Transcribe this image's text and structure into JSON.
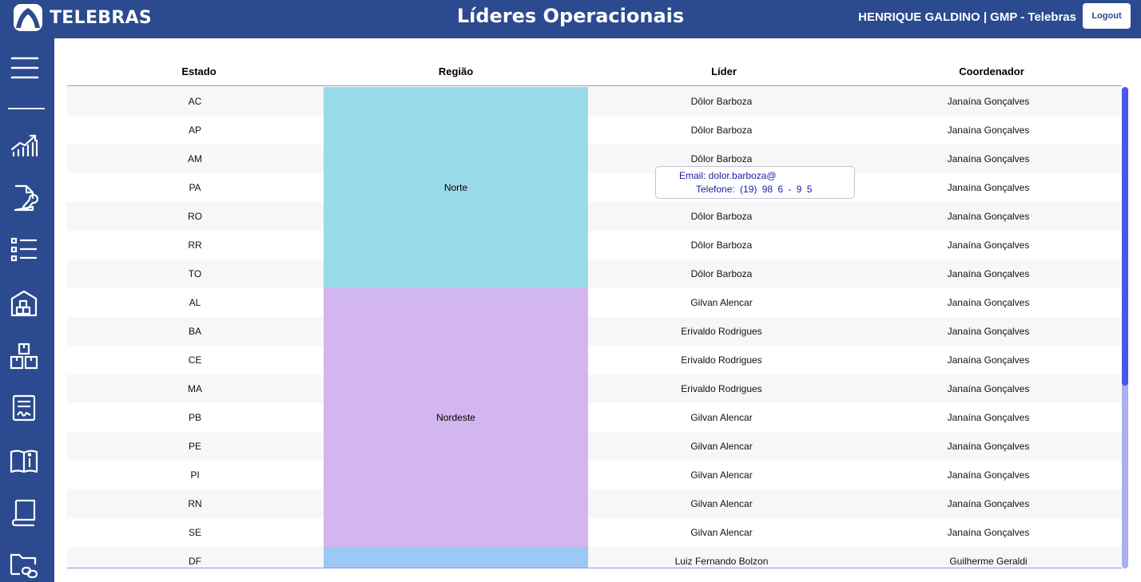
{
  "brand": {
    "name": "TELEBRAS"
  },
  "header": {
    "title": "Líderes Operacionais",
    "user": "HENRIQUE GALDINO | GMP - Telebras",
    "logout_label": "Logout"
  },
  "colors": {
    "primary": "#2b4a8f",
    "norte": "#9adbe9",
    "nordeste": "#d3b6ee",
    "centro_oeste": "#9bc8f5",
    "scroll_thumb": "#4c55ec"
  },
  "sidebar": {
    "items": [
      {
        "name": "menu-icon"
      },
      {
        "name": "chart-trend-icon"
      },
      {
        "name": "document-wrench-icon"
      },
      {
        "name": "checklist-icon"
      },
      {
        "name": "warehouse-icon"
      },
      {
        "name": "boxes-icon"
      },
      {
        "name": "contract-signature-icon"
      },
      {
        "name": "manual-info-icon"
      },
      {
        "name": "book-icon"
      },
      {
        "name": "folder-link-icon"
      }
    ]
  },
  "table": {
    "headers": {
      "estado": "Estado",
      "regiao": "Região",
      "lider": "Líder",
      "coordenador": "Coordenador"
    },
    "regions": [
      {
        "name": "Norte",
        "rows": 7,
        "color": "#9adbe9"
      },
      {
        "name": "Nordeste",
        "rows": 9,
        "color": "#d3b6ee"
      },
      {
        "name": "",
        "rows": 1,
        "color": "#9bc8f5"
      }
    ],
    "rows": [
      {
        "estado": "AC",
        "lider": "Dôlor Barboza",
        "coordenador": "Janaína Gonçalves"
      },
      {
        "estado": "AP",
        "lider": "Dôlor Barboza",
        "coordenador": "Janaína Gonçalves"
      },
      {
        "estado": "AM",
        "lider": "Dôlor Barboza",
        "coordenador": "Janaína Gonçalves"
      },
      {
        "estado": "PA",
        "lider": "",
        "coordenador": "Janaína Gonçalves"
      },
      {
        "estado": "RO",
        "lider": "Dôlor Barboza",
        "coordenador": "Janaína Gonçalves"
      },
      {
        "estado": "RR",
        "lider": "Dôlor Barboza",
        "coordenador": "Janaína Gonçalves"
      },
      {
        "estado": "TO",
        "lider": "Dôlor Barboza",
        "coordenador": "Janaína Gonçalves"
      },
      {
        "estado": "AL",
        "lider": "Gilvan Alencar",
        "coordenador": "Janaína Gonçalves"
      },
      {
        "estado": "BA",
        "lider": "Erivaldo Rodrigues",
        "coordenador": "Janaína Gonçalves"
      },
      {
        "estado": "CE",
        "lider": "Erivaldo Rodrigues",
        "coordenador": "Janaína Gonçalves"
      },
      {
        "estado": "MA",
        "lider": "Erivaldo Rodrigues",
        "coordenador": "Janaína Gonçalves"
      },
      {
        "estado": "PB",
        "lider": "Gilvan Alencar",
        "coordenador": "Janaína Gonçalves"
      },
      {
        "estado": "PE",
        "lider": "Gilvan Alencar",
        "coordenador": "Janaína Gonçalves"
      },
      {
        "estado": "PI",
        "lider": "Gilvan Alencar",
        "coordenador": "Janaína Gonçalves"
      },
      {
        "estado": "RN",
        "lider": "Gilvan Alencar",
        "coordenador": "Janaína Gonçalves"
      },
      {
        "estado": "SE",
        "lider": "Gilvan Alencar",
        "coordenador": "Janaína Gonçalves"
      },
      {
        "estado": "DF",
        "lider": "Luiz Fernando Bolzon",
        "coordenador": "Guilherme Geraldi"
      }
    ]
  },
  "tooltip": {
    "email": "Email: dolor.barboza@",
    "phone": "Telefone: (19) 98 6 - 9 5"
  }
}
